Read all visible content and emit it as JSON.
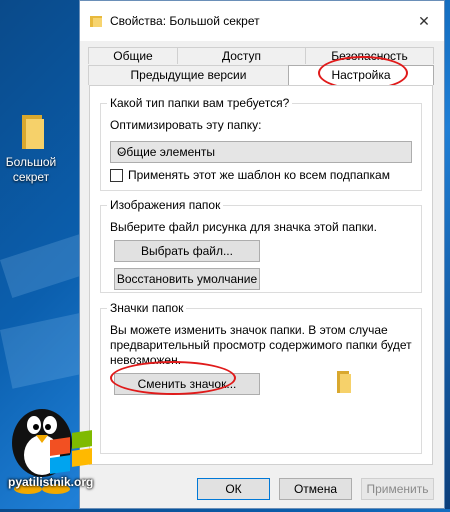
{
  "desktop": {
    "icon_label_line1": "Большой",
    "icon_label_line2": "секрет"
  },
  "window": {
    "title": "Свойства: Большой секрет",
    "close_glyph": "✕"
  },
  "tabs": {
    "row1": [
      "Общие",
      "Доступ",
      "Безопасность"
    ],
    "row2": [
      "Предыдущие версии",
      "Настройка"
    ],
    "active": "Настройка"
  },
  "group_type": {
    "legend": "Какой тип папки вам требуется?",
    "optimize_label": "Оптимизировать эту папку:",
    "select_value": "Общие элементы",
    "apply_checkbox_label": "Применять этот же шаблон ко всем подпапкам",
    "apply_checked": false
  },
  "group_images": {
    "legend": "Изображения папок",
    "description": "Выберите файл рисунка для значка этой папки.",
    "choose_file_button": "Выбрать файл...",
    "restore_default_button": "Восстановить умолчание"
  },
  "group_icons": {
    "legend": "Значки папок",
    "description_line1": "Вы можете изменить значок папки. В этом случае",
    "description_line2": "предварительный просмотр содержимого папки будет",
    "description_line3": "невозможен.",
    "change_icon_button": "Сменить значок..."
  },
  "footer": {
    "ok": "ОК",
    "cancel": "Отмена",
    "apply": "Применить"
  },
  "watermark": {
    "site": "pyatilistnik.org"
  },
  "colors": {
    "accent_blue": "#0078d7",
    "highlight_red": "#e01a1a",
    "folder_yellow": "#f6d16a"
  }
}
